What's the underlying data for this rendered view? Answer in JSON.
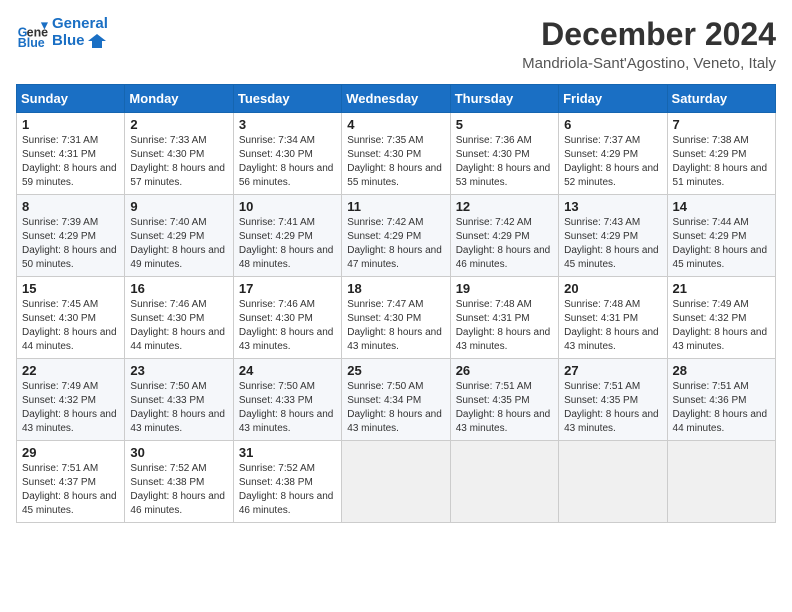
{
  "header": {
    "logo_line1": "General",
    "logo_line2": "Blue",
    "title": "December 2024",
    "subtitle": "Mandriola-Sant'Agostino, Veneto, Italy"
  },
  "weekdays": [
    "Sunday",
    "Monday",
    "Tuesday",
    "Wednesday",
    "Thursday",
    "Friday",
    "Saturday"
  ],
  "weeks": [
    [
      {
        "day": "1",
        "sunrise": "7:31 AM",
        "sunset": "4:31 PM",
        "daylight": "8 hours and 59 minutes."
      },
      {
        "day": "2",
        "sunrise": "7:33 AM",
        "sunset": "4:30 PM",
        "daylight": "8 hours and 57 minutes."
      },
      {
        "day": "3",
        "sunrise": "7:34 AM",
        "sunset": "4:30 PM",
        "daylight": "8 hours and 56 minutes."
      },
      {
        "day": "4",
        "sunrise": "7:35 AM",
        "sunset": "4:30 PM",
        "daylight": "8 hours and 55 minutes."
      },
      {
        "day": "5",
        "sunrise": "7:36 AM",
        "sunset": "4:30 PM",
        "daylight": "8 hours and 53 minutes."
      },
      {
        "day": "6",
        "sunrise": "7:37 AM",
        "sunset": "4:29 PM",
        "daylight": "8 hours and 52 minutes."
      },
      {
        "day": "7",
        "sunrise": "7:38 AM",
        "sunset": "4:29 PM",
        "daylight": "8 hours and 51 minutes."
      }
    ],
    [
      {
        "day": "8",
        "sunrise": "7:39 AM",
        "sunset": "4:29 PM",
        "daylight": "8 hours and 50 minutes."
      },
      {
        "day": "9",
        "sunrise": "7:40 AM",
        "sunset": "4:29 PM",
        "daylight": "8 hours and 49 minutes."
      },
      {
        "day": "10",
        "sunrise": "7:41 AM",
        "sunset": "4:29 PM",
        "daylight": "8 hours and 48 minutes."
      },
      {
        "day": "11",
        "sunrise": "7:42 AM",
        "sunset": "4:29 PM",
        "daylight": "8 hours and 47 minutes."
      },
      {
        "day": "12",
        "sunrise": "7:42 AM",
        "sunset": "4:29 PM",
        "daylight": "8 hours and 46 minutes."
      },
      {
        "day": "13",
        "sunrise": "7:43 AM",
        "sunset": "4:29 PM",
        "daylight": "8 hours and 45 minutes."
      },
      {
        "day": "14",
        "sunrise": "7:44 AM",
        "sunset": "4:29 PM",
        "daylight": "8 hours and 45 minutes."
      }
    ],
    [
      {
        "day": "15",
        "sunrise": "7:45 AM",
        "sunset": "4:30 PM",
        "daylight": "8 hours and 44 minutes."
      },
      {
        "day": "16",
        "sunrise": "7:46 AM",
        "sunset": "4:30 PM",
        "daylight": "8 hours and 44 minutes."
      },
      {
        "day": "17",
        "sunrise": "7:46 AM",
        "sunset": "4:30 PM",
        "daylight": "8 hours and 43 minutes."
      },
      {
        "day": "18",
        "sunrise": "7:47 AM",
        "sunset": "4:30 PM",
        "daylight": "8 hours and 43 minutes."
      },
      {
        "day": "19",
        "sunrise": "7:48 AM",
        "sunset": "4:31 PM",
        "daylight": "8 hours and 43 minutes."
      },
      {
        "day": "20",
        "sunrise": "7:48 AM",
        "sunset": "4:31 PM",
        "daylight": "8 hours and 43 minutes."
      },
      {
        "day": "21",
        "sunrise": "7:49 AM",
        "sunset": "4:32 PM",
        "daylight": "8 hours and 43 minutes."
      }
    ],
    [
      {
        "day": "22",
        "sunrise": "7:49 AM",
        "sunset": "4:32 PM",
        "daylight": "8 hours and 43 minutes."
      },
      {
        "day": "23",
        "sunrise": "7:50 AM",
        "sunset": "4:33 PM",
        "daylight": "8 hours and 43 minutes."
      },
      {
        "day": "24",
        "sunrise": "7:50 AM",
        "sunset": "4:33 PM",
        "daylight": "8 hours and 43 minutes."
      },
      {
        "day": "25",
        "sunrise": "7:50 AM",
        "sunset": "4:34 PM",
        "daylight": "8 hours and 43 minutes."
      },
      {
        "day": "26",
        "sunrise": "7:51 AM",
        "sunset": "4:35 PM",
        "daylight": "8 hours and 43 minutes."
      },
      {
        "day": "27",
        "sunrise": "7:51 AM",
        "sunset": "4:35 PM",
        "daylight": "8 hours and 43 minutes."
      },
      {
        "day": "28",
        "sunrise": "7:51 AM",
        "sunset": "4:36 PM",
        "daylight": "8 hours and 44 minutes."
      }
    ],
    [
      {
        "day": "29",
        "sunrise": "7:51 AM",
        "sunset": "4:37 PM",
        "daylight": "8 hours and 45 minutes."
      },
      {
        "day": "30",
        "sunrise": "7:52 AM",
        "sunset": "4:38 PM",
        "daylight": "8 hours and 46 minutes."
      },
      {
        "day": "31",
        "sunrise": "7:52 AM",
        "sunset": "4:38 PM",
        "daylight": "8 hours and 46 minutes."
      },
      null,
      null,
      null,
      null
    ]
  ],
  "labels": {
    "sunrise": "Sunrise:",
    "sunset": "Sunset:",
    "daylight": "Daylight:"
  }
}
